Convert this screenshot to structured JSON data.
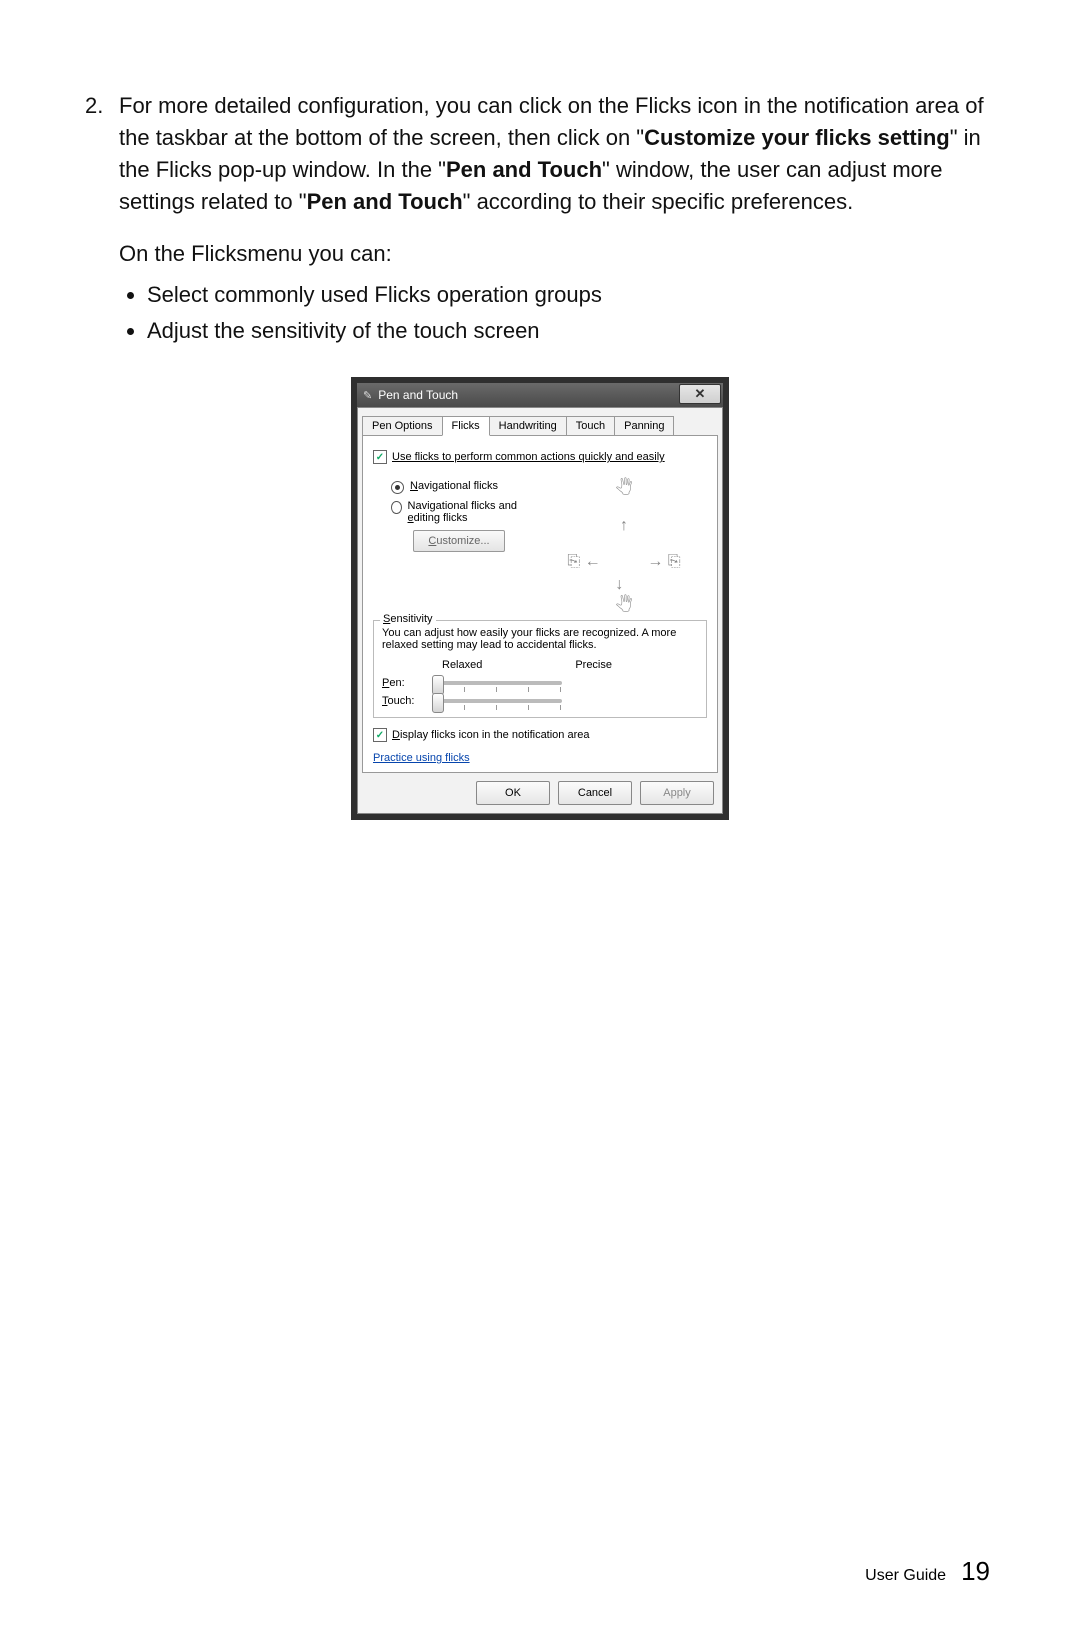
{
  "doc": {
    "item_number": "2.",
    "para1_a": "For more detailed configuration, you can click on the Flicks icon in the notification area of the taskbar at the bottom of the screen, then click on \"",
    "para1_b_bold": "Customize your flicks setting",
    "para1_c": "\" in the Flicks pop-up window. In the \"",
    "para1_d_bold": "Pen and Touch",
    "para1_e": "\" window, the user can adjust more settings related to \"",
    "para1_f_bold": "Pen and Touch",
    "para1_g": "\" according to their specific preferences.",
    "para2": "On the Flicksmenu you can:",
    "bullets": [
      "Select commonly used Flicks operation groups",
      "Adjust the sensitivity of the touch screen"
    ]
  },
  "dialog": {
    "title": "Pen and Touch",
    "tabs": [
      "Pen Options",
      "Flicks",
      "Handwriting",
      "Touch",
      "Panning"
    ],
    "active_tab": "Flicks",
    "use_flicks_label": "Use flicks to perform common actions quickly and easily",
    "radio1": "Navigational flicks",
    "radio2": "Navigational flicks and editing flicks",
    "customize_btn": "Customize...",
    "sens_legend": "Sensitivity",
    "sens_desc": "You can adjust how easily your flicks are recognized. A more relaxed setting may lead to accidental flicks.",
    "relaxed": "Relaxed",
    "precise": "Precise",
    "pen_label": "Pen:",
    "touch_label": "Touch:",
    "display_icon_label": "Display flicks icon in the notification area",
    "practice_link": "Practice using flicks",
    "ok": "OK",
    "cancel": "Cancel",
    "apply": "Apply"
  },
  "footer": {
    "guide": "User Guide",
    "page": "19"
  }
}
